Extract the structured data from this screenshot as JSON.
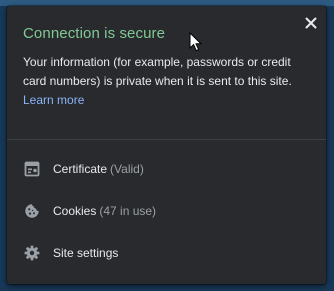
{
  "popup": {
    "title": "Connection is secure",
    "description": "Your information (for example, passwords or credit card numbers) is private when it is sent to this site.",
    "learn_more": "Learn more",
    "close_icon": "close-icon",
    "items": [
      {
        "label": "Certificate",
        "detail": "(Valid)",
        "icon": "certificate-icon"
      },
      {
        "label": "Cookies",
        "detail": "(47 in use)",
        "icon": "cookie-icon"
      },
      {
        "label": "Site settings",
        "detail": "",
        "icon": "gear-icon"
      }
    ]
  },
  "colors": {
    "secure_green": "#81c995",
    "link_blue": "#8ab4f8",
    "panel_bg": "#292a2d"
  }
}
